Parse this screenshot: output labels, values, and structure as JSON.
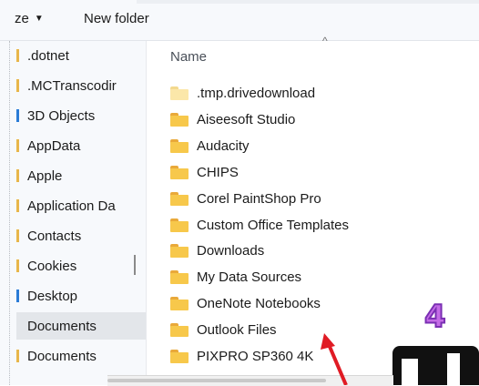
{
  "toolbar": {
    "organize_label": "ze",
    "organize_caret": "▼",
    "new_folder_label": "New folder"
  },
  "nav": {
    "items": [
      {
        "label": ".dotnet",
        "marker": "folder"
      },
      {
        "label": ".MCTranscodir",
        "marker": "folder"
      },
      {
        "label": "3D Objects",
        "marker": "blue"
      },
      {
        "label": "AppData",
        "marker": "folder"
      },
      {
        "label": "Apple",
        "marker": "folder"
      },
      {
        "label": "Application Da",
        "marker": "folder"
      },
      {
        "label": "Contacts",
        "marker": "folder"
      },
      {
        "label": "Cookies",
        "marker": "folder"
      },
      {
        "label": "Desktop",
        "marker": "blue"
      },
      {
        "label": "Documents",
        "marker": "none",
        "selected": true
      },
      {
        "label": "Documents",
        "marker": "folder"
      }
    ]
  },
  "content": {
    "column_name": "Name",
    "sort_indicator": "^",
    "files": [
      {
        "name": ".tmp.drivedownload",
        "style": "light"
      },
      {
        "name": "Aiseesoft Studio",
        "style": "normal"
      },
      {
        "name": "Audacity",
        "style": "normal"
      },
      {
        "name": "CHIPS",
        "style": "normal"
      },
      {
        "name": "Corel PaintShop Pro",
        "style": "normal"
      },
      {
        "name": "Custom Office Templates",
        "style": "normal"
      },
      {
        "name": "Downloads",
        "style": "normal"
      },
      {
        "name": "My Data Sources",
        "style": "normal"
      },
      {
        "name": "OneNote Notebooks",
        "style": "normal"
      },
      {
        "name": "Outlook Files",
        "style": "normal"
      },
      {
        "name": "PIXPRO SP360 4K",
        "style": "normal"
      }
    ]
  },
  "overlay": {
    "step_badge": "4",
    "arrow_color": "#e01b24",
    "badge_color": "#c46be6"
  }
}
